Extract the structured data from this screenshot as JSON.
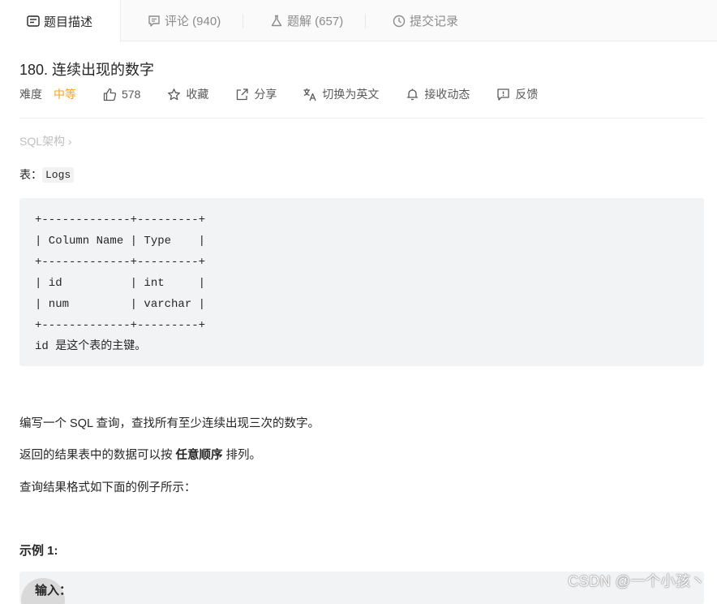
{
  "tabs": [
    {
      "label": "题目描述",
      "icon": "description-icon",
      "active": true
    },
    {
      "label": "评论 (940)",
      "icon": "comment-icon",
      "active": false
    },
    {
      "label": "题解 (657)",
      "icon": "flask-icon",
      "active": false
    },
    {
      "label": "提交记录",
      "icon": "clock-icon",
      "active": false
    }
  ],
  "problem": {
    "title": "180. 连续出现的数字",
    "difficulty_label": "难度",
    "difficulty_value": "中等",
    "likes": "578",
    "favorite_label": "收藏",
    "share_label": "分享",
    "translate_label": "切换为英文",
    "subscribe_label": "接收动态",
    "feedback_label": "反馈",
    "category": "SQL架构 ›"
  },
  "content": {
    "table_prefix": "表：",
    "table_name": "Logs",
    "schema_lines": [
      "+-------------+---------+",
      "| Column Name | Type    |",
      "+-------------+---------+",
      "| id          | int     |",
      "| num         | varchar |",
      "+-------------+---------+",
      "id 是这个表的主键。"
    ],
    "para1": "编写一个 SQL 查询，查找所有至少连续出现三次的数字。",
    "para2_pre": "返回的结果表中的数据可以按 ",
    "para2_bold": "任意顺序",
    "para2_post": " 排列。",
    "para3": "查询结果格式如下面的例子所示：",
    "example_title": "示例 1:",
    "example_input_label": "输入："
  },
  "watermark": "CSDN @一个小孩丶",
  "colors": {
    "accent_orange": "#ffa116",
    "muted_text": "#8c8c8c",
    "code_bg": "#f2f3f5"
  }
}
